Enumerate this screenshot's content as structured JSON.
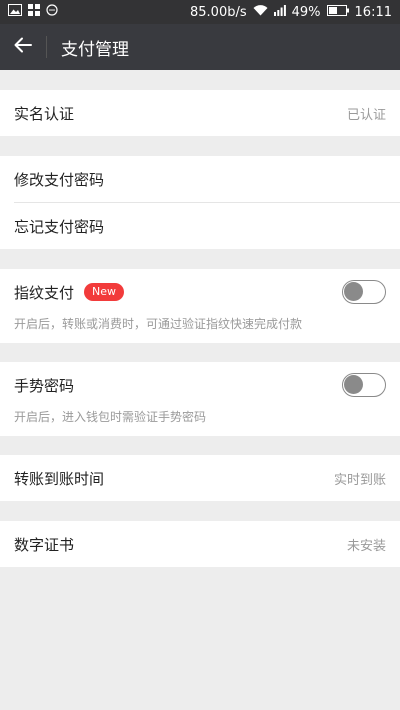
{
  "status_bar": {
    "network_speed": "85.00b/s",
    "battery": "49%",
    "time": "16:11"
  },
  "header": {
    "title": "支付管理"
  },
  "items": {
    "realname": {
      "label": "实名认证",
      "value": "已认证"
    },
    "modify_password": {
      "label": "修改支付密码"
    },
    "forgot_password": {
      "label": "忘记支付密码"
    },
    "fingerprint": {
      "label": "指纹支付",
      "badge": "New",
      "desc": "开启后，转账或消费时，可通过验证指纹快速完成付款",
      "enabled": false
    },
    "gesture": {
      "label": "手势密码",
      "desc": "开启后，进入钱包时需验证手势密码",
      "enabled": false
    },
    "transfer_time": {
      "label": "转账到账时间",
      "value": "实时到账"
    },
    "certificate": {
      "label": "数字证书",
      "value": "未安装"
    }
  },
  "colors": {
    "nav_bg": "#393a3f",
    "badge": "#f23b3b",
    "page_bg": "#ededed"
  }
}
